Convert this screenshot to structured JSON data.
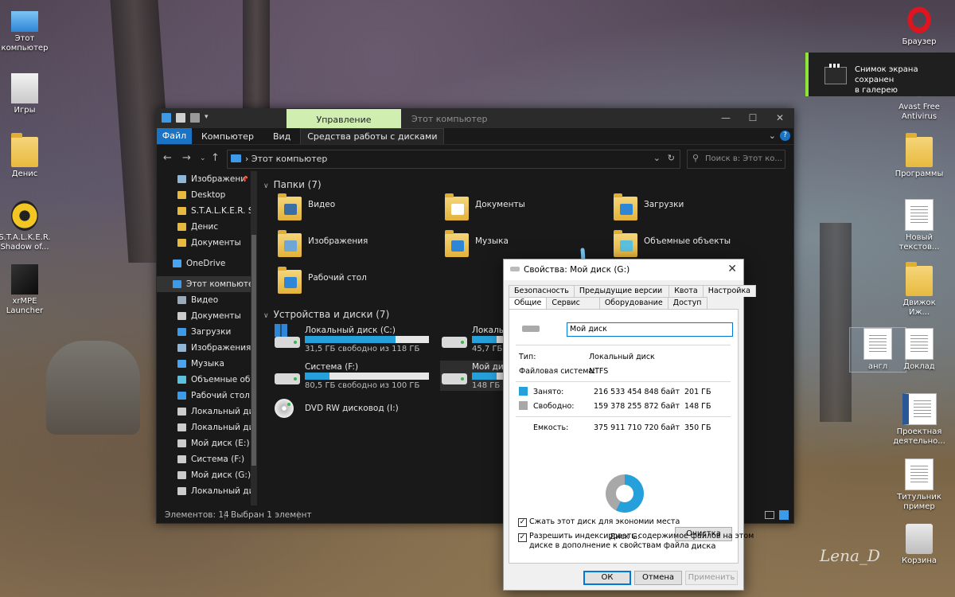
{
  "desktop": {
    "left_icons": [
      {
        "label": "Этот компьютер",
        "icon": "monitor-icon"
      },
      {
        "label": "Игры",
        "icon": "shortcut-icon"
      },
      {
        "label": "Денис",
        "icon": "folder-icon"
      },
      {
        "label": "S.T.A.L.K.E.R. Shadow of...",
        "icon": "radiation-icon"
      },
      {
        "label": "xrMPE Launcher",
        "icon": "game-icon"
      }
    ],
    "right_icons": [
      {
        "label": "Браузер",
        "icon": "opera-icon"
      },
      {
        "label": "Avast Free Antivirus",
        "icon": "avast-icon"
      },
      {
        "label": "Программы",
        "icon": "folder-icon"
      },
      {
        "label": "Новый текстов...",
        "icon": "text-file-icon"
      },
      {
        "label": "Движок Иж...",
        "icon": "folder-icon"
      },
      {
        "label": "англ",
        "icon": "document-icon"
      },
      {
        "label": "Доклад",
        "icon": "document-icon"
      },
      {
        "label": "Проектная деятельно...",
        "icon": "word-icon"
      },
      {
        "label": "Титульник пример",
        "icon": "document-icon"
      },
      {
        "label": "Корзина",
        "icon": "recycle-bin-icon"
      }
    ],
    "watermark": "Lena_D"
  },
  "toast": {
    "text_line1": "Снимок экрана сохранен",
    "text_line2": "в галерею"
  },
  "explorer": {
    "manage_tab": "Управление",
    "title": "Этот компьютер",
    "ribbon": {
      "file": "Файл",
      "computer": "Компьютер",
      "view": "Вид",
      "drive_tools": "Средства работы с дисками",
      "help": "?"
    },
    "address": "Этот компьютер",
    "search_placeholder": "Поиск в: Этот ко...",
    "nav": [
      {
        "label": "Изображени",
        "icon": "pictures-icon",
        "color": "#8fb6d8",
        "indent": 1,
        "pin": true
      },
      {
        "label": "Desktop",
        "icon": "folder-icon",
        "color": "#e8b93f",
        "indent": 1
      },
      {
        "label": "S.T.A.L.K.E.R. Sha",
        "icon": "folder-icon",
        "color": "#e8b93f",
        "indent": 1
      },
      {
        "label": "Денис",
        "icon": "folder-icon",
        "color": "#e8b93f",
        "indent": 1
      },
      {
        "label": "Документы",
        "icon": "folder-icon",
        "color": "#e8b93f",
        "indent": 1
      },
      {
        "label": "",
        "spacer": true
      },
      {
        "label": "OneDrive",
        "icon": "cloud-icon",
        "color": "#4aa3f0",
        "indent": 0
      },
      {
        "label": "",
        "spacer": true
      },
      {
        "label": "Этот компьютер",
        "icon": "monitor-icon",
        "color": "#3d9ae8",
        "indent": 0,
        "selected": true
      },
      {
        "label": "Видео",
        "icon": "video-icon",
        "color": "#9ab",
        "indent": 1
      },
      {
        "label": "Документы",
        "icon": "documents-icon",
        "color": "#ccc",
        "indent": 1
      },
      {
        "label": "Загрузки",
        "icon": "download-icon",
        "color": "#3d9ae8",
        "indent": 1
      },
      {
        "label": "Изображения",
        "icon": "pictures-icon",
        "color": "#8fb6d8",
        "indent": 1
      },
      {
        "label": "Музыка",
        "icon": "music-icon",
        "color": "#4aa3f0",
        "indent": 1
      },
      {
        "label": "Объемные объе",
        "icon": "3d-objects-icon",
        "color": "#5bc0de",
        "indent": 1
      },
      {
        "label": "Рабочий стол",
        "icon": "desktop-icon",
        "color": "#3d9ae8",
        "indent": 1
      },
      {
        "label": "Локальный дис",
        "icon": "drive-icon",
        "color": "#ccc",
        "indent": 1
      },
      {
        "label": "Локальный дис",
        "icon": "drive-icon",
        "color": "#ccc",
        "indent": 1
      },
      {
        "label": "Мой диск (E:)",
        "icon": "drive-icon",
        "color": "#ccc",
        "indent": 1
      },
      {
        "label": "Система (F:)",
        "icon": "drive-icon",
        "color": "#ccc",
        "indent": 1
      },
      {
        "label": "Мой диск (G:)",
        "icon": "drive-icon",
        "color": "#ccc",
        "indent": 1
      },
      {
        "label": "Локальный дис",
        "icon": "drive-icon",
        "color": "#ccc",
        "indent": 1
      }
    ],
    "folders_header": "Папки (7)",
    "folders": [
      {
        "label": "Видео",
        "overlay": "#3a6ea5"
      },
      {
        "label": "Документы",
        "overlay": "#ffffff"
      },
      {
        "label": "Загрузки",
        "overlay": "#2f86d6"
      },
      {
        "label": "Изображения",
        "overlay": "#6fa6d6"
      },
      {
        "label": "Музыка",
        "overlay": "#2f86d6"
      },
      {
        "label": "Объемные объекты",
        "overlay": "#5bc0de"
      },
      {
        "label": "Рабочий стол",
        "overlay": "#2f86d6"
      }
    ],
    "drives_header": "Устройства и диски (7)",
    "drives": [
      {
        "label": "Локальный диск (C:)",
        "free": "31,5 ГБ свободно из 118 ГБ",
        "used_fraction": 0.73,
        "windows": true
      },
      {
        "label": "Локальный диск",
        "free": "45,7 ГБ",
        "used_fraction": 0.2
      },
      {
        "label": "Система (F:)",
        "free": "80,5 ГБ свободно из 100 ГБ",
        "used_fraction": 0.2
      },
      {
        "label": "Мой диск (G:)",
        "free": "148 ГБ",
        "used_fraction": 0.2,
        "highlight": true
      },
      {
        "label": "DVD RW дисковод (I:)",
        "dvd": true
      }
    ],
    "status_items": "Элементов: 14",
    "status_selected": "Выбран 1 элемент"
  },
  "dialog": {
    "title": "Свойства: Мой диск (G:)",
    "tabs_row1": [
      "Безопасность",
      "Предыдущие версии",
      "Квота",
      "Настройка"
    ],
    "tabs_row2": [
      "Общие",
      "Сервис",
      "Оборудование",
      "Доступ"
    ],
    "name_value": "Мой диск",
    "type_label": "Тип:",
    "type_value": "Локальный диск",
    "fs_label": "Файловая система:",
    "fs_value": "NTFS",
    "used_label": "Занято:",
    "used_bytes": "216 533 454 848 байт",
    "used_gb": "201 ГБ",
    "free_label": "Свободно:",
    "free_bytes": "159 378 255 872 байт",
    "free_gb": "148 ГБ",
    "capacity_label": "Емкость:",
    "capacity_bytes": "375 911 710 720 байт",
    "capacity_gb": "350 ГБ",
    "used_color": "#26a0da",
    "free_color": "#a8a8a8",
    "disk_label": "Диск G:",
    "cleanup_button": "Очистка диска",
    "compress_label": "Сжать этот диск для экономии места",
    "index_label_1": "Разрешить индексировать содержимое файлов на этом",
    "index_label_2": "диске в дополнение к свойствам файла",
    "ok": "ОК",
    "cancel": "Отмена",
    "apply": "Применить"
  }
}
